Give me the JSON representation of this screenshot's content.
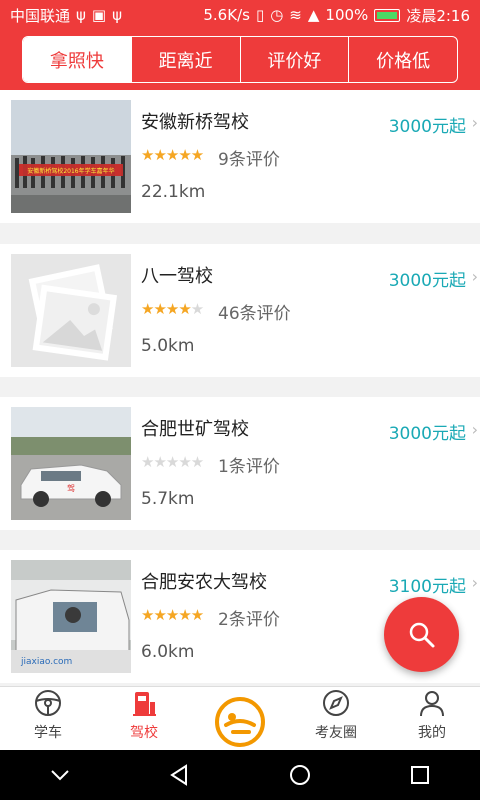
{
  "status_bar": {
    "carrier": "中国联通",
    "speed": "5.6K/s",
    "battery": "100%",
    "time": "凌晨2:16"
  },
  "sort_tabs": [
    {
      "label": "拿照快",
      "active": true
    },
    {
      "label": "距离近",
      "active": false
    },
    {
      "label": "评价好",
      "active": false
    },
    {
      "label": "价格低",
      "active": false
    }
  ],
  "schools": [
    {
      "name": "安徽新桥驾校",
      "price": "3000元起",
      "rating": 5,
      "reviews": "9条评价",
      "distance": "22.1km",
      "photo": "group-banner-photo",
      "banner_text": "安徽新桥驾校2016年学车嘉年华"
    },
    {
      "name": "八一驾校",
      "price": "3000元起",
      "rating": 4,
      "reviews": "46条评价",
      "distance": "5.0km",
      "photo": "placeholder-image"
    },
    {
      "name": "合肥世矿驾校",
      "price": "3000元起",
      "rating": 0,
      "reviews": "1条评价",
      "distance": "5.7km",
      "photo": "training-car-photo"
    },
    {
      "name": "合肥安农大驾校",
      "price": "3100元起",
      "rating": 5,
      "reviews": "2条评价",
      "distance": "6.0km",
      "photo": "car-interior-photo",
      "watermark": "jiaxiao.com"
    }
  ],
  "bottom_tabs": [
    {
      "label": "学车",
      "icon": "steering-wheel-icon",
      "active": false
    },
    {
      "label": "驾校",
      "icon": "school-icon",
      "active": true
    },
    {
      "label": "",
      "icon": "app-logo-icon",
      "active": false
    },
    {
      "label": "考友圈",
      "icon": "compass-icon",
      "active": false
    },
    {
      "label": "我的",
      "icon": "person-icon",
      "active": false
    }
  ],
  "colors": {
    "brand": "#ee3b3b",
    "price": "#1aa9b5",
    "star": "#f5a623"
  }
}
